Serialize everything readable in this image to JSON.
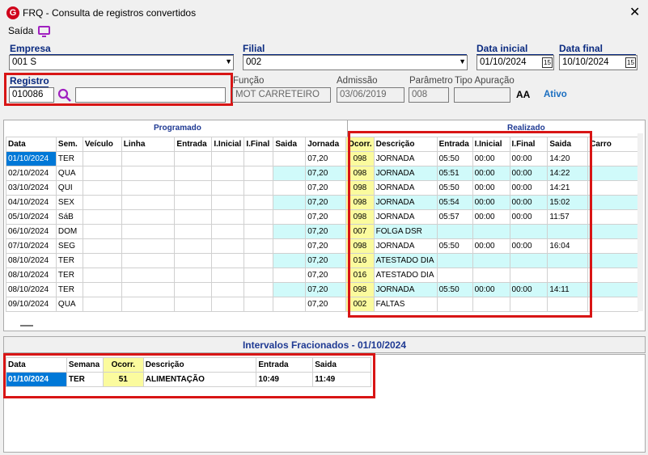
{
  "window": {
    "title": "FRQ - Consulta de registros convertidos",
    "close": "✕"
  },
  "menu": {
    "saida": "Saída"
  },
  "form": {
    "empresa_label": "Empresa",
    "empresa_value": "001 S",
    "filial_label": "Filial",
    "filial_value": "002",
    "data_inicial_label": "Data inicial",
    "data_inicial_value": "01/10/2024",
    "data_final_label": "Data final",
    "data_final_value": "10/10/2024",
    "registro_label": "Registro",
    "registro_value": "010086",
    "registro_name": "",
    "funcao_label": "Função",
    "funcao_value": "MOT CARRETEIRO",
    "admissao_label": "Admissão",
    "admissao_value": "03/06/2019",
    "parametro_label": "Parâmetro",
    "parametro_value": "008",
    "tipo_apuracao_label": "Tipo Apuração",
    "tipo_apuracao_value": "",
    "font_icon": "AA",
    "status": "Ativo"
  },
  "grid": {
    "programado_title": "Programado",
    "realizado_title": "Realizado",
    "headers": [
      "Data",
      "Sem.",
      "Veículo",
      "Linha",
      "Entrada",
      "I.Inicial",
      "I.Final",
      "Saida",
      "Jornada",
      "Ocorr.",
      "Descrição",
      "Entrada",
      "I.Inicial",
      "I.Final",
      "Saida",
      "Carro"
    ],
    "rows": [
      [
        "01/10/2024",
        "TER",
        "",
        "",
        "",
        "",
        "",
        "",
        "07,20",
        "098",
        "JORNADA",
        "05:50",
        "00:00",
        "00:00",
        "14:20",
        ""
      ],
      [
        "02/10/2024",
        "QUA",
        "",
        "",
        "",
        "",
        "",
        "",
        "07,20",
        "098",
        "JORNADA",
        "05:51",
        "00:00",
        "00:00",
        "14:22",
        ""
      ],
      [
        "03/10/2024",
        "QUI",
        "",
        "",
        "",
        "",
        "",
        "",
        "07,20",
        "098",
        "JORNADA",
        "05:50",
        "00:00",
        "00:00",
        "14:21",
        ""
      ],
      [
        "04/10/2024",
        "SEX",
        "",
        "",
        "",
        "",
        "",
        "",
        "07,20",
        "098",
        "JORNADA",
        "05:54",
        "00:00",
        "00:00",
        "15:02",
        ""
      ],
      [
        "05/10/2024",
        "SáB",
        "",
        "",
        "",
        "",
        "",
        "",
        "07,20",
        "098",
        "JORNADA",
        "05:57",
        "00:00",
        "00:00",
        "11:57",
        ""
      ],
      [
        "06/10/2024",
        "DOM",
        "",
        "",
        "",
        "",
        "",
        "",
        "07,20",
        "007",
        "FOLGA DSR",
        "",
        "",
        "",
        "",
        ""
      ],
      [
        "07/10/2024",
        "SEG",
        "",
        "",
        "",
        "",
        "",
        "",
        "07,20",
        "098",
        "JORNADA",
        "05:50",
        "00:00",
        "00:00",
        "16:04",
        ""
      ],
      [
        "08/10/2024",
        "TER",
        "",
        "",
        "",
        "",
        "",
        "",
        "07,20",
        "016",
        "ATESTADO DIA",
        "",
        "",
        "",
        "",
        ""
      ],
      [
        "08/10/2024",
        "TER",
        "",
        "",
        "",
        "",
        "",
        "",
        "07,20",
        "016",
        "ATESTADO DIA",
        "",
        "",
        "",
        "",
        ""
      ],
      [
        "08/10/2024",
        "TER",
        "",
        "",
        "",
        "",
        "",
        "",
        "07,20",
        "098",
        "JORNADA",
        "05:50",
        "00:00",
        "00:00",
        "14:11",
        ""
      ],
      [
        "09/10/2024",
        "QUA",
        "",
        "",
        "",
        "",
        "",
        "",
        "07,20",
        "002",
        "FALTAS",
        "",
        "",
        "",
        "",
        ""
      ]
    ]
  },
  "fracionados": {
    "title": "Intervalos Fracionados - 01/10/2024",
    "headers": [
      "Data",
      "Semana",
      "Ocorr.",
      "Descrição",
      "Entrada",
      "Saida"
    ],
    "rows": [
      [
        "01/10/2024",
        "TER",
        "51",
        "ALIMENTAÇÃO",
        "10:49",
        "11:49"
      ]
    ]
  },
  "colors": {
    "accent": "#0a2a80",
    "highlight": "#fbfb9e",
    "alt_row": "#d0fafa",
    "selection": "#0078d7",
    "red_box": "#d81515"
  }
}
